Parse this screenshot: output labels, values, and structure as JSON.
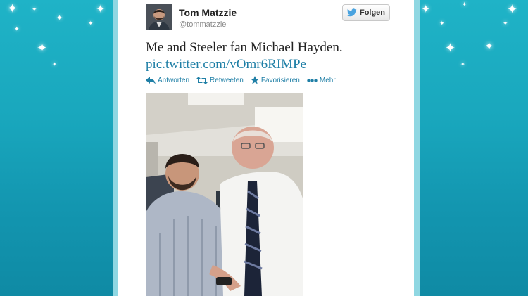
{
  "tweet": {
    "author_name": "Tom Matzzie",
    "author_handle": "@tommatzzie",
    "follow_label": "Folgen",
    "text": "Me and Steeler fan Michael Hayden.",
    "link": "pic.twitter.com/vOmr6RIMPe"
  },
  "actions": {
    "reply": "Antworten",
    "retweet": "Retweeten",
    "favorite": "Favorisieren",
    "more": "Mehr"
  },
  "icons": {
    "twitter_bird": "twitter-bird-icon",
    "reply": "reply-arrow-icon",
    "retweet": "retweet-icon",
    "favorite": "star-icon",
    "more": "ellipsis-icon",
    "decoration": "sparkle-icon"
  },
  "colors": {
    "background": "#19a7bd",
    "card": "#ffffff",
    "link": "#1f7fa6",
    "twitter_blue": "#4aa3df"
  }
}
